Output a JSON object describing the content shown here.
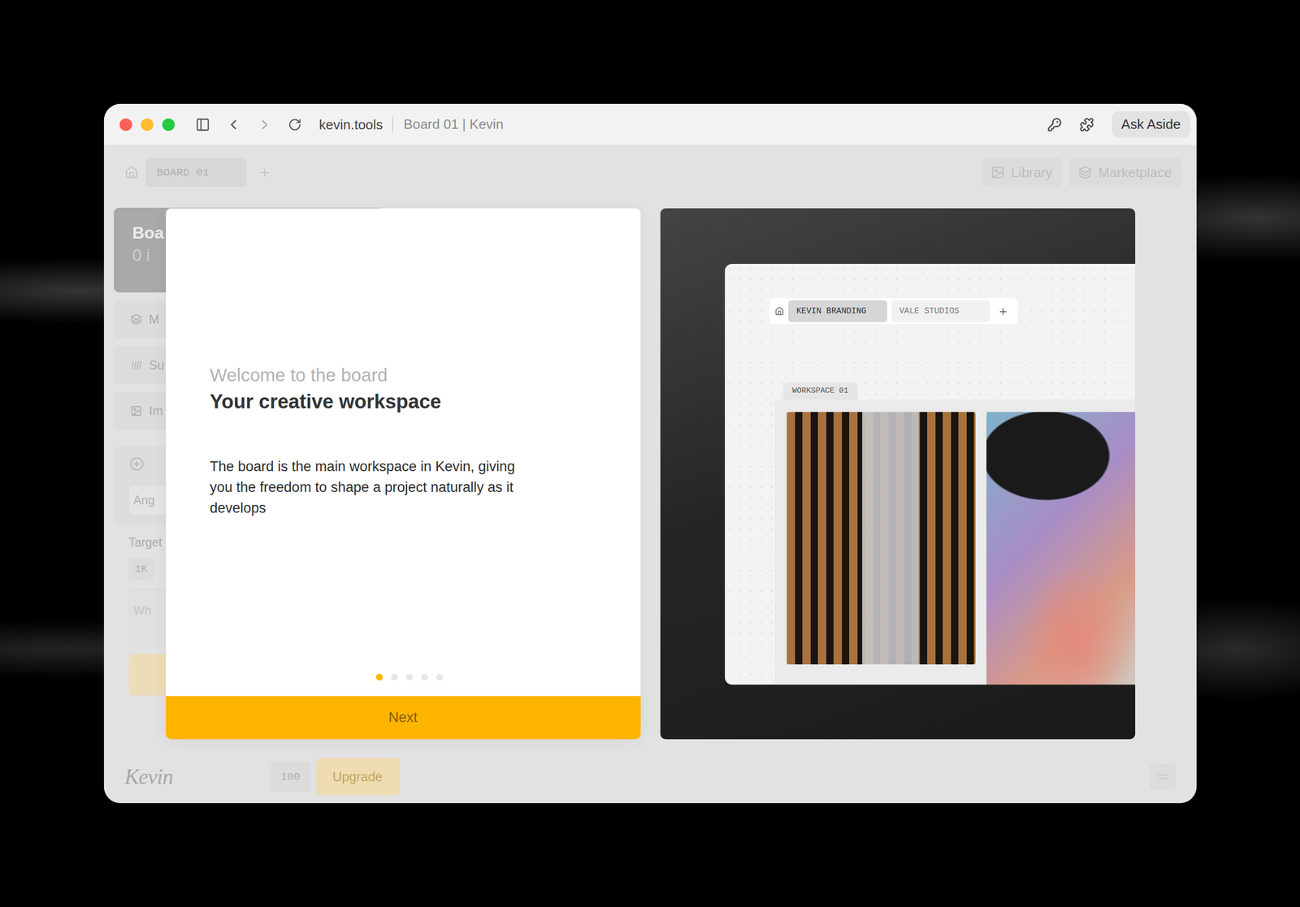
{
  "window": {
    "url": "kevin.tools",
    "title": "Board 01 | Kevin"
  },
  "toolbar": {
    "button": "Ask Aside"
  },
  "app": {
    "tabs": [
      {
        "label": "BOARD 01",
        "selected": true
      }
    ],
    "add": "+",
    "links": [
      "Library",
      "Marketplace"
    ],
    "sidebar": {
      "card": {
        "title": "Boa",
        "subtitle": "0 i"
      },
      "items": [
        "M",
        "Su",
        "Im"
      ],
      "field": "Ang",
      "label": "Target",
      "chip": "1K",
      "prompt": "Wh"
    },
    "footer": {
      "logo": "Kevin",
      "credits": "100",
      "upgrade": "Upgrade"
    }
  },
  "dialog": {
    "eyebrow": "Welcome to the board",
    "title": "Your creative workspace",
    "body": "The board is the main workspace in Kevin, giving you the freedom to shape a project naturally as it develops",
    "steps": [
      {
        "selected": true
      },
      {
        "selected": false
      },
      {
        "selected": false
      },
      {
        "selected": false
      },
      {
        "selected": false
      }
    ],
    "button": "Next",
    "preview": {
      "tabs": [
        {
          "label": "KEVIN BRANDING",
          "selected": true
        },
        {
          "label": "VALE STUDIOS",
          "selected": false
        }
      ],
      "add": "+",
      "workspace": "WORKSPACE 01"
    }
  }
}
